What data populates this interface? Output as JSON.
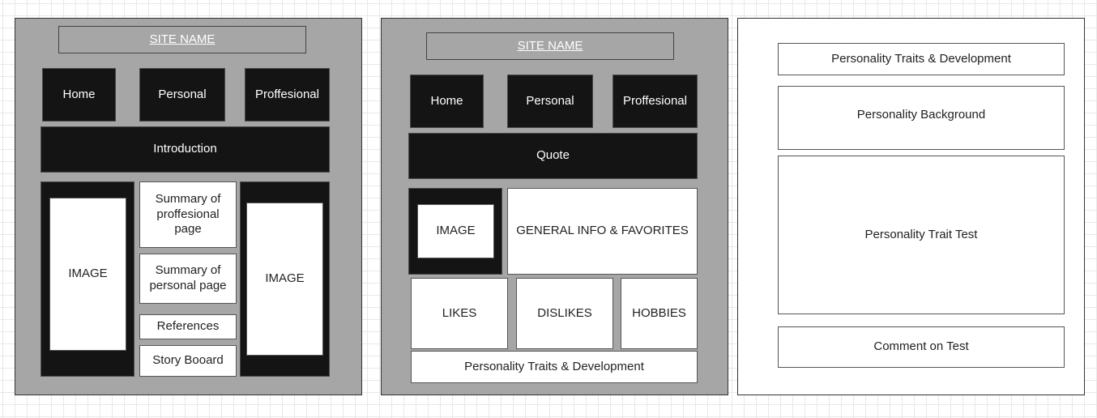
{
  "panel1": {
    "site_name": "SITE NAME",
    "nav": [
      "Home",
      "Personal",
      "Proffesional"
    ],
    "banner": "Introduction",
    "left_image": "IMAGE",
    "right_image": "IMAGE",
    "middle": [
      "Summary of proffesional page",
      "Summary of personal page",
      "References",
      "Story Booard"
    ]
  },
  "panel2": {
    "site_name": "SITE NAME",
    "nav": [
      "Home",
      "Personal",
      "Proffesional"
    ],
    "banner": "Quote",
    "image": "IMAGE",
    "general_info": "GENERAL INFO & FAVORITES",
    "likes": "LIKES",
    "dislikes": "DISLIKES",
    "hobbies": "HOBBIES",
    "traits": "Personality Traits & Development"
  },
  "panel3": {
    "items": [
      "Personality Traits & Development",
      "Personality Background",
      "Personality Trait Test",
      "Comment on Test"
    ]
  }
}
